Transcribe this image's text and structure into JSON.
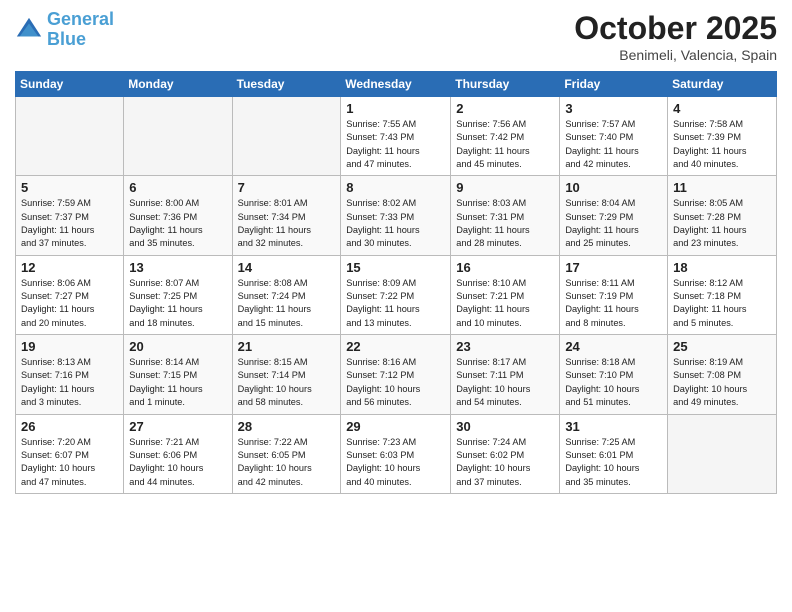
{
  "header": {
    "logo_line1": "General",
    "logo_line2": "Blue",
    "month": "October 2025",
    "location": "Benimeli, Valencia, Spain"
  },
  "weekdays": [
    "Sunday",
    "Monday",
    "Tuesday",
    "Wednesday",
    "Thursday",
    "Friday",
    "Saturday"
  ],
  "weeks": [
    [
      {
        "day": "",
        "info": ""
      },
      {
        "day": "",
        "info": ""
      },
      {
        "day": "",
        "info": ""
      },
      {
        "day": "1",
        "info": "Sunrise: 7:55 AM\nSunset: 7:43 PM\nDaylight: 11 hours\nand 47 minutes."
      },
      {
        "day": "2",
        "info": "Sunrise: 7:56 AM\nSunset: 7:42 PM\nDaylight: 11 hours\nand 45 minutes."
      },
      {
        "day": "3",
        "info": "Sunrise: 7:57 AM\nSunset: 7:40 PM\nDaylight: 11 hours\nand 42 minutes."
      },
      {
        "day": "4",
        "info": "Sunrise: 7:58 AM\nSunset: 7:39 PM\nDaylight: 11 hours\nand 40 minutes."
      }
    ],
    [
      {
        "day": "5",
        "info": "Sunrise: 7:59 AM\nSunset: 7:37 PM\nDaylight: 11 hours\nand 37 minutes."
      },
      {
        "day": "6",
        "info": "Sunrise: 8:00 AM\nSunset: 7:36 PM\nDaylight: 11 hours\nand 35 minutes."
      },
      {
        "day": "7",
        "info": "Sunrise: 8:01 AM\nSunset: 7:34 PM\nDaylight: 11 hours\nand 32 minutes."
      },
      {
        "day": "8",
        "info": "Sunrise: 8:02 AM\nSunset: 7:33 PM\nDaylight: 11 hours\nand 30 minutes."
      },
      {
        "day": "9",
        "info": "Sunrise: 8:03 AM\nSunset: 7:31 PM\nDaylight: 11 hours\nand 28 minutes."
      },
      {
        "day": "10",
        "info": "Sunrise: 8:04 AM\nSunset: 7:29 PM\nDaylight: 11 hours\nand 25 minutes."
      },
      {
        "day": "11",
        "info": "Sunrise: 8:05 AM\nSunset: 7:28 PM\nDaylight: 11 hours\nand 23 minutes."
      }
    ],
    [
      {
        "day": "12",
        "info": "Sunrise: 8:06 AM\nSunset: 7:27 PM\nDaylight: 11 hours\nand 20 minutes."
      },
      {
        "day": "13",
        "info": "Sunrise: 8:07 AM\nSunset: 7:25 PM\nDaylight: 11 hours\nand 18 minutes."
      },
      {
        "day": "14",
        "info": "Sunrise: 8:08 AM\nSunset: 7:24 PM\nDaylight: 11 hours\nand 15 minutes."
      },
      {
        "day": "15",
        "info": "Sunrise: 8:09 AM\nSunset: 7:22 PM\nDaylight: 11 hours\nand 13 minutes."
      },
      {
        "day": "16",
        "info": "Sunrise: 8:10 AM\nSunset: 7:21 PM\nDaylight: 11 hours\nand 10 minutes."
      },
      {
        "day": "17",
        "info": "Sunrise: 8:11 AM\nSunset: 7:19 PM\nDaylight: 11 hours\nand 8 minutes."
      },
      {
        "day": "18",
        "info": "Sunrise: 8:12 AM\nSunset: 7:18 PM\nDaylight: 11 hours\nand 5 minutes."
      }
    ],
    [
      {
        "day": "19",
        "info": "Sunrise: 8:13 AM\nSunset: 7:16 PM\nDaylight: 11 hours\nand 3 minutes."
      },
      {
        "day": "20",
        "info": "Sunrise: 8:14 AM\nSunset: 7:15 PM\nDaylight: 11 hours\nand 1 minute."
      },
      {
        "day": "21",
        "info": "Sunrise: 8:15 AM\nSunset: 7:14 PM\nDaylight: 10 hours\nand 58 minutes."
      },
      {
        "day": "22",
        "info": "Sunrise: 8:16 AM\nSunset: 7:12 PM\nDaylight: 10 hours\nand 56 minutes."
      },
      {
        "day": "23",
        "info": "Sunrise: 8:17 AM\nSunset: 7:11 PM\nDaylight: 10 hours\nand 54 minutes."
      },
      {
        "day": "24",
        "info": "Sunrise: 8:18 AM\nSunset: 7:10 PM\nDaylight: 10 hours\nand 51 minutes."
      },
      {
        "day": "25",
        "info": "Sunrise: 8:19 AM\nSunset: 7:08 PM\nDaylight: 10 hours\nand 49 minutes."
      }
    ],
    [
      {
        "day": "26",
        "info": "Sunrise: 7:20 AM\nSunset: 6:07 PM\nDaylight: 10 hours\nand 47 minutes."
      },
      {
        "day": "27",
        "info": "Sunrise: 7:21 AM\nSunset: 6:06 PM\nDaylight: 10 hours\nand 44 minutes."
      },
      {
        "day": "28",
        "info": "Sunrise: 7:22 AM\nSunset: 6:05 PM\nDaylight: 10 hours\nand 42 minutes."
      },
      {
        "day": "29",
        "info": "Sunrise: 7:23 AM\nSunset: 6:03 PM\nDaylight: 10 hours\nand 40 minutes."
      },
      {
        "day": "30",
        "info": "Sunrise: 7:24 AM\nSunset: 6:02 PM\nDaylight: 10 hours\nand 37 minutes."
      },
      {
        "day": "31",
        "info": "Sunrise: 7:25 AM\nSunset: 6:01 PM\nDaylight: 10 hours\nand 35 minutes."
      },
      {
        "day": "",
        "info": ""
      }
    ]
  ]
}
